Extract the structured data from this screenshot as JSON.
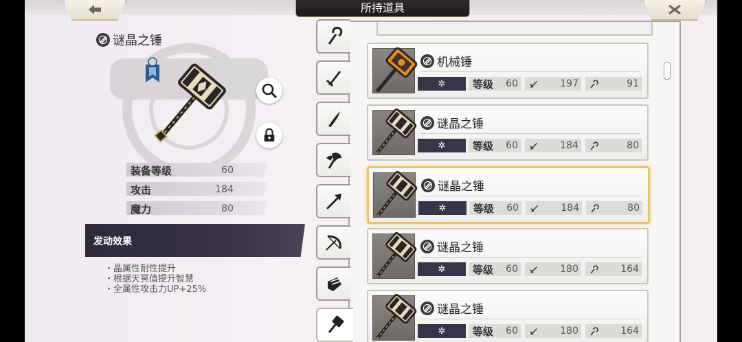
{
  "header": {
    "title": "所持道具",
    "back_icon": "back-arrow-icon",
    "close_icon": "close-icon"
  },
  "detail": {
    "element_icon": "element-icon",
    "name": "谜晶之锤",
    "stats": [
      {
        "label": "装备等级",
        "value": "60"
      },
      {
        "label": "攻击",
        "value": "184"
      },
      {
        "label": "魔力",
        "value": "80"
      }
    ],
    "effect_title": "发动效果",
    "effects": [
      "・晶属性耐性提升",
      "・根据天冥值提升智慧",
      "・全属性攻击力UP+25%"
    ]
  },
  "category_tabs": [
    {
      "icon": "staff-icon"
    },
    {
      "icon": "sword-icon"
    },
    {
      "icon": "katana-icon"
    },
    {
      "icon": "axe-icon"
    },
    {
      "icon": "spear-icon"
    },
    {
      "icon": "bow-icon"
    },
    {
      "icon": "fist-icon"
    },
    {
      "icon": "hammer-icon",
      "active": true
    }
  ],
  "items": [
    {
      "name": "机械锤",
      "level_label": "等级",
      "level": "60",
      "attack": "197",
      "magic": "91",
      "variant": "mech"
    },
    {
      "name": "谜晶之锤",
      "level_label": "等级",
      "level": "60",
      "attack": "184",
      "magic": "80"
    },
    {
      "name": "谜晶之锤",
      "level_label": "等级",
      "level": "60",
      "attack": "184",
      "magic": "80",
      "selected": true
    },
    {
      "name": "谜晶之锤",
      "level_label": "等级",
      "level": "60",
      "attack": "180",
      "magic": "164"
    },
    {
      "name": "谜晶之锤",
      "level_label": "等级",
      "level": "60",
      "attack": "180",
      "magic": "164"
    }
  ],
  "colors": {
    "dark_panel": "#3a3448",
    "selected_border": "#f1c35f",
    "gold_trim": "#c9b98c"
  }
}
